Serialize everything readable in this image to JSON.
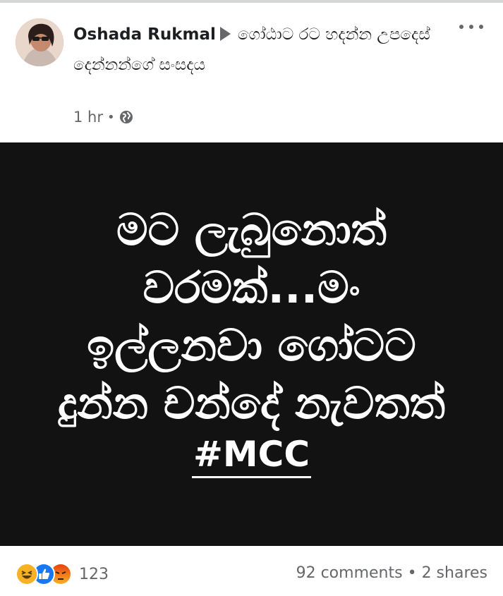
{
  "post": {
    "author": "Oshada Rukmal",
    "group": "ගෝඨාට රට හදන්න උපදෙස් දෙන්නන්ගේ සංසදය",
    "timestamp": "1 hr",
    "separator": "•",
    "privacy_icon": "globe-icon",
    "more_icon": "more-options-icon"
  },
  "image": {
    "lines": [
      "මට ලැබුනොත්",
      "වරමක්...මං",
      "ඉල්ලනවා ගෝටට",
      "දුන්න චන්දේ නැවතත්"
    ],
    "hashtag": "#MCC",
    "background": "#121212",
    "text_color": "#ffffff"
  },
  "footer": {
    "reaction_icons": [
      "haha-icon",
      "like-icon",
      "angry-icon"
    ],
    "reaction_count": "123",
    "comments": "92 comments",
    "stat_separator": "•",
    "shares": "2 shares"
  },
  "colors": {
    "secondary_text": "#65676b",
    "like_blue": "#1877f2",
    "angry_orange": "#e9710f",
    "haha_yellow": "#f7b125"
  }
}
